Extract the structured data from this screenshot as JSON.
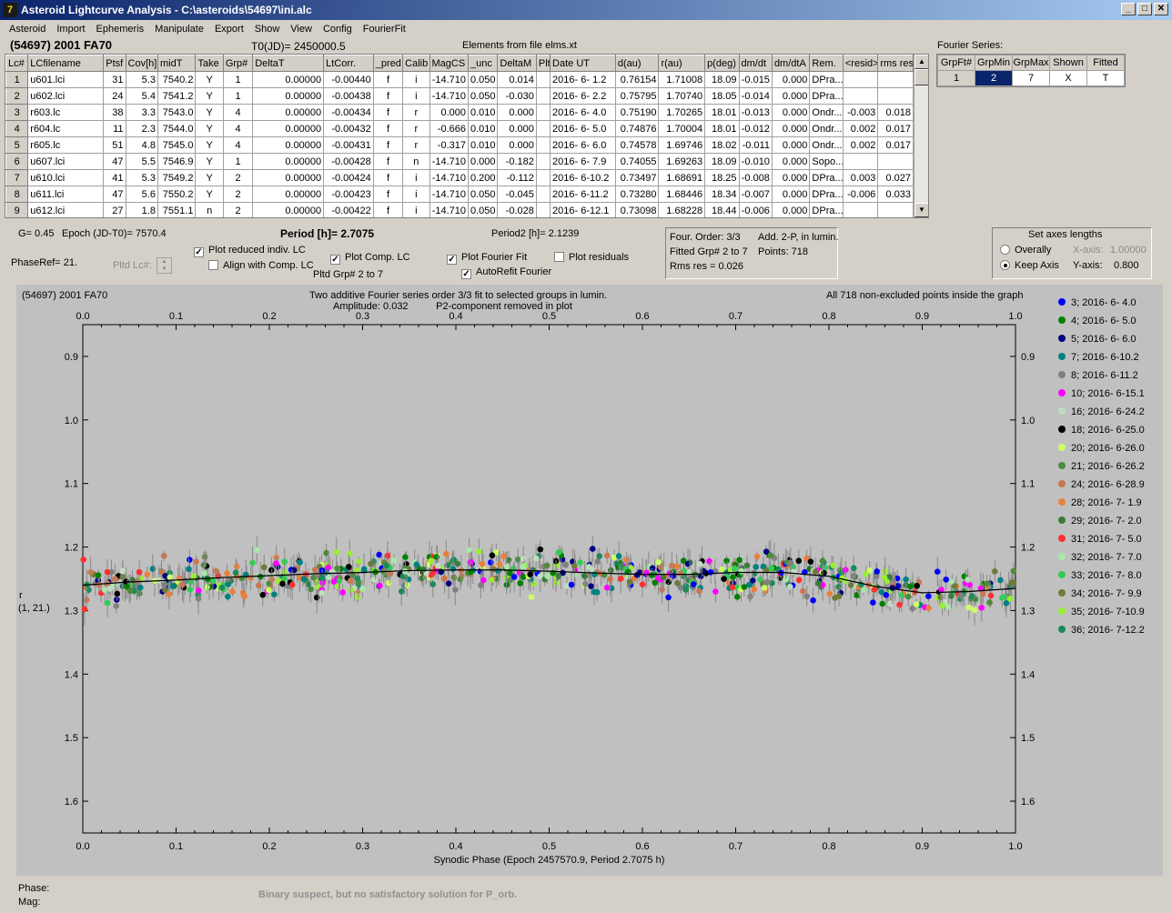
{
  "window": {
    "title": "Asteroid Lightcurve Analysis - C:\\asteroids\\54697\\ini.alc",
    "icon_text": "7",
    "buttons": [
      "_",
      "□",
      "✕"
    ]
  },
  "menu": [
    "Asteroid",
    "Import",
    "Ephemeris",
    "Manipulate",
    "Export",
    "Show",
    "View",
    "Config",
    "FourierFit"
  ],
  "header": {
    "target": "(54697) 2001 FA70",
    "t0": "T0(JD)= 2450000.5",
    "elements": "Elements from file elms.xt"
  },
  "grid": {
    "columns": [
      "Lc#",
      "LCfilename",
      "Ptsf",
      "Cov[h]",
      "midT",
      "Take",
      "Grp#",
      "DeltaT",
      "LtCorr.",
      "_pred",
      "Calib",
      "MagCS",
      "_unc",
      "DeltaM",
      "Plt",
      "Date UT",
      "d(au)",
      "r(au)",
      "p(deg)",
      "dm/dt",
      "dm/dtA",
      "Rem.",
      "<resid>",
      "rms res"
    ],
    "rows": [
      [
        "1",
        "u601.lci",
        "31",
        "5.3",
        "7540.2",
        "Y",
        "1",
        "0.00000",
        "-0.00440",
        "f",
        "i",
        "-14.710",
        "0.050",
        "0.014",
        "",
        "2016- 6- 1.2",
        "0.76154",
        "1.71008",
        "18.09",
        "-0.015",
        "0.000",
        "DPra...",
        "",
        ""
      ],
      [
        "2",
        "u602.lci",
        "24",
        "5.4",
        "7541.2",
        "Y",
        "1",
        "0.00000",
        "-0.00438",
        "f",
        "i",
        "-14.710",
        "0.050",
        "-0.030",
        "",
        "2016- 6- 2.2",
        "0.75795",
        "1.70740",
        "18.05",
        "-0.014",
        "0.000",
        "DPra...",
        "",
        ""
      ],
      [
        "3",
        "r603.lc",
        "38",
        "3.3",
        "7543.0",
        "Y",
        "4",
        "0.00000",
        "-0.00434",
        "f",
        "r",
        "0.000",
        "0.010",
        "0.000",
        "",
        "2016- 6- 4.0",
        "0.75190",
        "1.70265",
        "18.01",
        "-0.013",
        "0.000",
        "Ondr...",
        "-0.003",
        "0.018"
      ],
      [
        "4",
        "r604.lc",
        "11",
        "2.3",
        "7544.0",
        "Y",
        "4",
        "0.00000",
        "-0.00432",
        "f",
        "r",
        "-0.666",
        "0.010",
        "0.000",
        "",
        "2016- 6- 5.0",
        "0.74876",
        "1.70004",
        "18.01",
        "-0.012",
        "0.000",
        "Ondr...",
        "0.002",
        "0.017"
      ],
      [
        "5",
        "r605.lc",
        "51",
        "4.8",
        "7545.0",
        "Y",
        "4",
        "0.00000",
        "-0.00431",
        "f",
        "r",
        "-0.317",
        "0.010",
        "0.000",
        "",
        "2016- 6- 6.0",
        "0.74578",
        "1.69746",
        "18.02",
        "-0.011",
        "0.000",
        "Ondr...",
        "0.002",
        "0.017"
      ],
      [
        "6",
        "u607.lci",
        "47",
        "5.5",
        "7546.9",
        "Y",
        "1",
        "0.00000",
        "-0.00428",
        "f",
        "n",
        "-14.710",
        "0.000",
        "-0.182",
        "",
        "2016- 6- 7.9",
        "0.74055",
        "1.69263",
        "18.09",
        "-0.010",
        "0.000",
        "Sopo...",
        "",
        ""
      ],
      [
        "7",
        "u610.lci",
        "41",
        "5.3",
        "7549.2",
        "Y",
        "2",
        "0.00000",
        "-0.00424",
        "f",
        "i",
        "-14.710",
        "0.200",
        "-0.112",
        "",
        "2016- 6-10.2",
        "0.73497",
        "1.68691",
        "18.25",
        "-0.008",
        "0.000",
        "DPra...",
        "0.003",
        "0.027"
      ],
      [
        "8",
        "u611.lci",
        "47",
        "5.6",
        "7550.2",
        "Y",
        "2",
        "0.00000",
        "-0.00423",
        "f",
        "i",
        "-14.710",
        "0.050",
        "-0.045",
        "",
        "2016- 6-11.2",
        "0.73280",
        "1.68446",
        "18.34",
        "-0.007",
        "0.000",
        "DPra...",
        "-0.006",
        "0.033"
      ],
      [
        "9",
        "u612.lci",
        "27",
        "1.8",
        "7551.1",
        "n",
        "2",
        "0.00000",
        "-0.00422",
        "f",
        "i",
        "-14.710",
        "0.050",
        "-0.028",
        "",
        "2016- 6-12.1",
        "0.73098",
        "1.68228",
        "18.44",
        "-0.006",
        "0.000",
        "DPra...",
        "",
        ""
      ]
    ]
  },
  "fourier_series": {
    "label": "Fourier Series:",
    "columns": [
      "GrpFt#",
      "GrpMin",
      "GrpMax",
      "Shown",
      "Fitted"
    ],
    "row": [
      "1",
      "2",
      "7",
      "X",
      "T"
    ]
  },
  "controls": {
    "g": "G= 0.45",
    "epoch": "Epoch (JD-T0)= 7570.4",
    "period": "Period [h]= 2.7075",
    "period2": "Period2 [h]= 2.1239",
    "phaseref": "PhaseRef= 21.",
    "pltd_lc": "Pltd Lc#:",
    "plot_reduced": "Plot reduced indiv. LC",
    "align_comp": "Align with Comp. LC",
    "plot_comp": "Plot Comp. LC",
    "pltd_grp": "Pltd Grp#  2   to   7",
    "plot_fourier": "Plot Fourier Fit",
    "autorefit": "AutoRefit Fourier",
    "plot_residuals": "Plot residuals"
  },
  "fit_info": {
    "order": "Four. Order:  3/3",
    "add": "Add. 2-P, in lumin.",
    "fitted": "Fitted Grp# 2 to 7",
    "points": "Points: 718",
    "rms": "Rms res     = 0.026"
  },
  "axes_box": {
    "title": "Set axes lengths",
    "overally": "Overally",
    "keep": "Keep Axis",
    "xaxis_label": "X-axis:",
    "xaxis_value": "1.00000",
    "yaxis_label": "Y-axis:",
    "yaxis_value": "0.800"
  },
  "chart_data": {
    "type": "scatter",
    "header_left": "(54697) 2001 FA70",
    "header_center_1": "Two additive Fourier series order 3/3 fit to selected groups in lumin.",
    "header_center_2": "Amplitude: 0.032          P2-component removed in plot",
    "header_right": "All 718 non-excluded points inside the graph",
    "xlabel": "Synodic Phase (Epoch 2457570.9, Period 2.7075 h)",
    "ylabel_1": "r",
    "ylabel_2": "(1, 21.)",
    "xlim": [
      0.0,
      1.0
    ],
    "ylim": [
      1.65,
      0.85
    ],
    "y_inverted": true,
    "xticks": [
      "0.0",
      "0.1",
      "0.2",
      "0.3",
      "0.4",
      "0.5",
      "0.6",
      "0.7",
      "0.8",
      "0.9",
      "1.0"
    ],
    "yticks": [
      "0.9",
      "1.0",
      "1.1",
      "1.2",
      "1.3",
      "1.4",
      "1.5",
      "1.6"
    ],
    "fit_curve": {
      "x": [
        0.0,
        0.05,
        0.1,
        0.15,
        0.2,
        0.25,
        0.3,
        0.35,
        0.4,
        0.45,
        0.5,
        0.55,
        0.6,
        0.65,
        0.7,
        0.75,
        0.8,
        0.85,
        0.9,
        0.95,
        1.0
      ],
      "y": [
        1.26,
        1.255,
        1.252,
        1.248,
        1.245,
        1.242,
        1.24,
        1.237,
        1.236,
        1.236,
        1.238,
        1.241,
        1.243,
        1.243,
        1.24,
        1.24,
        1.246,
        1.262,
        1.272,
        1.27,
        1.265
      ]
    },
    "series": [
      {
        "name": "3; 2016- 6- 4.0",
        "color": "#0000ff"
      },
      {
        "name": "4; 2016- 6- 5.0",
        "color": "#008000"
      },
      {
        "name": "5; 2016- 6- 6.0",
        "color": "#000080"
      },
      {
        "name": "7; 2016- 6-10.2",
        "color": "#008080"
      },
      {
        "name": "8; 2016- 6-11.2",
        "color": "#808080"
      },
      {
        "name": "10; 2016- 6-15.1",
        "color": "#ff00ff"
      },
      {
        "name": "16; 2016- 6-24.2",
        "color": "#c0dcc0"
      },
      {
        "name": "18; 2016- 6-25.0",
        "color": "#000000"
      },
      {
        "name": "20; 2016- 6-26.0",
        "color": "#ccff66"
      },
      {
        "name": "21; 2016- 6-26.2",
        "color": "#4c8c3c"
      },
      {
        "name": "24; 2016- 6-28.9",
        "color": "#c87850"
      },
      {
        "name": "28; 2016- 7- 1.9",
        "color": "#e8803c"
      },
      {
        "name": "29; 2016- 7- 2.0",
        "color": "#3c7a3c"
      },
      {
        "name": "31; 2016- 7- 5.0",
        "color": "#ff3030"
      },
      {
        "name": "32; 2016- 7- 7.0",
        "color": "#a8e8a8"
      },
      {
        "name": "33; 2016- 7- 8.0",
        "color": "#33cc55"
      },
      {
        "name": "34; 2016- 7- 9.9",
        "color": "#6b7b3a"
      },
      {
        "name": "35; 2016- 7-10.9",
        "color": "#99ee33"
      },
      {
        "name": "36; 2016- 7-12.2",
        "color": "#1a8a5a"
      }
    ]
  },
  "footer": {
    "phase": "Phase:",
    "mag": "Mag:",
    "note": "Binary suspect, but no satisfactory solution for P_orb."
  }
}
